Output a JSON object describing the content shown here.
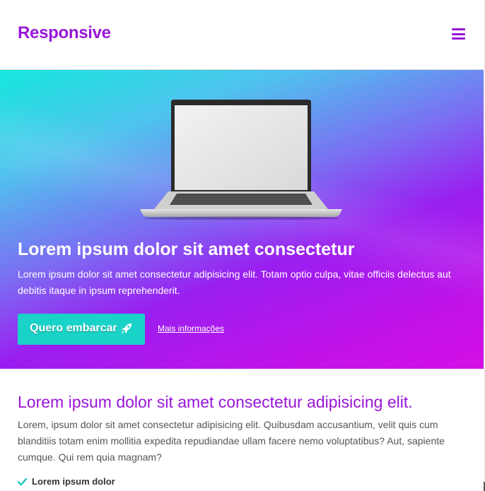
{
  "header": {
    "brand": "Responsive",
    "menu_icon": "hamburger-menu-icon",
    "brand_color": "#9a16d8"
  },
  "hero": {
    "image": "laptop-image",
    "title": "Lorem ipsum dolor sit amet consectetur",
    "text": "Lorem ipsum dolor sit amet consectetur adipisicing elit. Totam optio culpa, vitae officiis delectus aut debitis itaque in ipsum reprehenderit.",
    "cta_label": "Quero embarcar",
    "cta_icon": "rocket-icon",
    "cta_color": "#19d2c8",
    "link_label": "Mais informações"
  },
  "section": {
    "title": "Lorem ipsum dolor sit amet consectetur adipisicing elit.",
    "text": "Lorem, ipsum dolor sit amet consectetur adipisicing elit. Quibusdam accusantium, velit quis cum blanditiis totam enim mollitia expedita repudiandae ullam facere nemo voluptatibus? Aut, sapiente cumque. Qui rem quia magnam?",
    "features": [
      {
        "icon": "check-icon",
        "label": "Lorem ipsum dolor"
      }
    ]
  }
}
